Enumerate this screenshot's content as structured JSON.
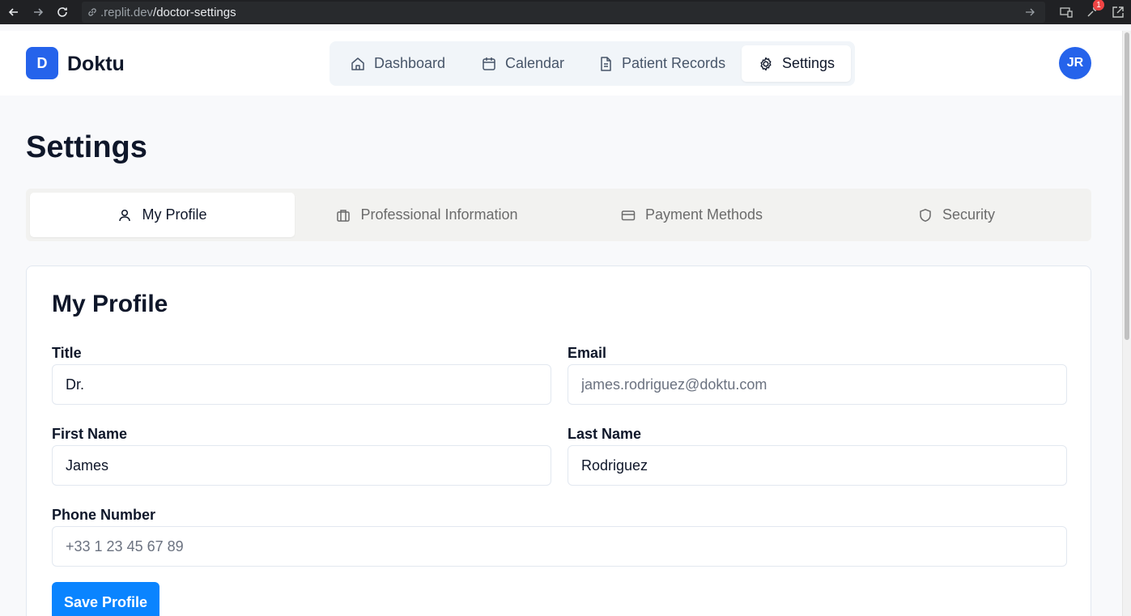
{
  "browser": {
    "url_domain": ".replit.dev",
    "url_path": "/doctor-settings",
    "notification_count": "1"
  },
  "app": {
    "logo_letter": "D",
    "brand": "Doktu",
    "avatar_initials": "JR",
    "accent_color": "#2563eb"
  },
  "nav": {
    "items": [
      {
        "label": "Dashboard",
        "icon": "home-icon"
      },
      {
        "label": "Calendar",
        "icon": "calendar-icon"
      },
      {
        "label": "Patient Records",
        "icon": "file-text-icon"
      },
      {
        "label": "Settings",
        "icon": "gear-icon",
        "active": true
      }
    ]
  },
  "page": {
    "title": "Settings"
  },
  "tabs": [
    {
      "label": "My Profile",
      "icon": "user-icon",
      "active": true
    },
    {
      "label": "Professional Information",
      "icon": "briefcase-icon"
    },
    {
      "label": "Payment Methods",
      "icon": "credit-card-icon"
    },
    {
      "label": "Security",
      "icon": "shield-icon"
    }
  ],
  "profile": {
    "heading": "My Profile",
    "title_label": "Title",
    "title_value": "Dr.",
    "email_label": "Email",
    "email_placeholder": "james.rodriguez@doktu.com",
    "first_name_label": "First Name",
    "first_name_value": "James",
    "last_name_label": "Last Name",
    "last_name_value": "Rodriguez",
    "phone_label": "Phone Number",
    "phone_placeholder": "+33 1 23 45 67 89",
    "save_label": "Save Profile"
  }
}
